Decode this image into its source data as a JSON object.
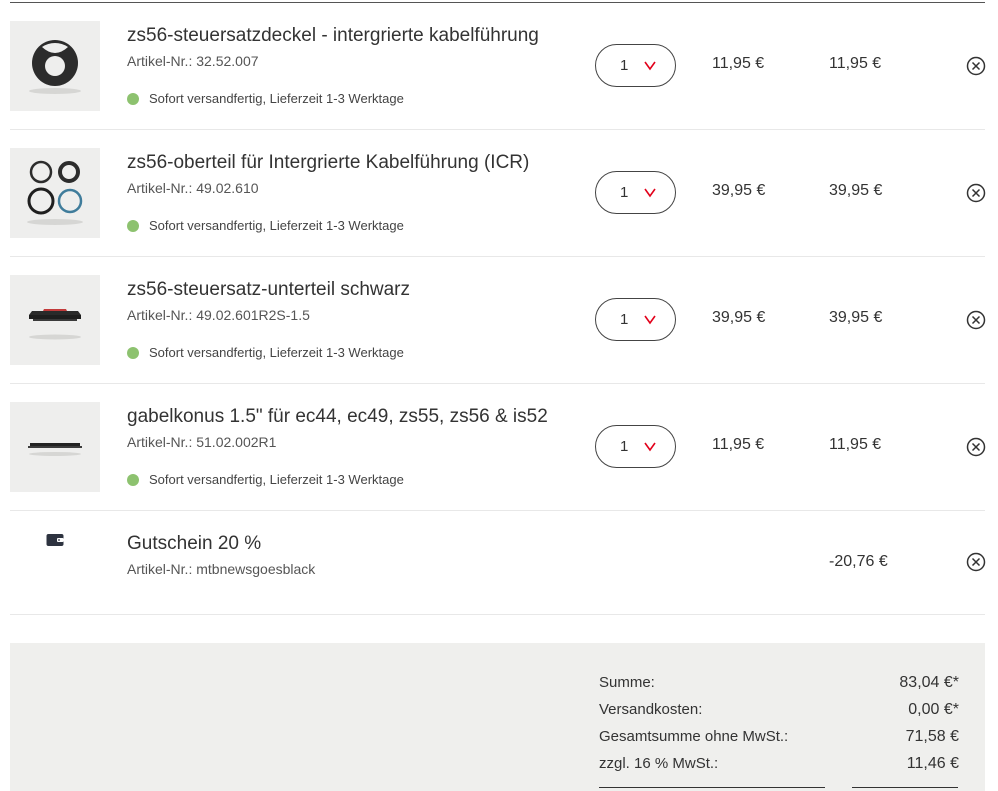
{
  "cart": {
    "items": [
      {
        "title": "zs56-steuersatzdeckel - intergrierte kabelführung",
        "article": "Artikel-Nr.: 32.52.007",
        "availability": "Sofort versandfertig, Lieferzeit 1-3 Werktage",
        "quantity": "1",
        "unit_price": "11,95 €",
        "total_price": "11,95 €",
        "image_icon": "headset-cover-image"
      },
      {
        "title": "zs56-oberteil für Intergrierte Kabelführung (ICR)",
        "article": "Artikel-Nr.: 49.02.610",
        "availability": "Sofort versandfertig, Lieferzeit 1-3 Werktage",
        "quantity": "1",
        "unit_price": "39,95 €",
        "total_price": "39,95 €",
        "image_icon": "headset-rings-image"
      },
      {
        "title": "zs56-steuersatz-unterteil schwarz",
        "article": "Artikel-Nr.: 49.02.601R2S-1.5",
        "availability": "Sofort versandfertig, Lieferzeit 1-3 Werktage",
        "quantity": "1",
        "unit_price": "39,95 €",
        "total_price": "39,95 €",
        "image_icon": "headset-cup-image"
      },
      {
        "title": "gabelkonus 1.5\" für ec44, ec49, zs55, zs56 & is52",
        "article": "Artikel-Nr.: 51.02.002R1",
        "availability": "Sofort versandfertig, Lieferzeit 1-3 Werktage",
        "quantity": "1",
        "unit_price": "11,95 €",
        "total_price": "11,95 €",
        "image_icon": "crown-race-image"
      }
    ],
    "voucher": {
      "title": "Gutschein 20 %",
      "article": "Artikel-Nr.: mtbnewsgoesblack",
      "total_price": "-20,76 €",
      "icon": "wallet-icon"
    }
  },
  "summary": {
    "sum_label": "Summe:",
    "sum_value": "83,04 €*",
    "shipping_label": "Versandkosten:",
    "shipping_value": "0,00 €*",
    "net_label": "Gesamtsumme ohne MwSt.:",
    "net_value": "71,58 €",
    "vat_label": "zzgl. 16 % MwSt.:",
    "vat_value": "11,46 €"
  },
  "colors": {
    "availability_dot": "#8dc26f",
    "chevron": "#e2001a",
    "summary_bg": "#efefed"
  }
}
